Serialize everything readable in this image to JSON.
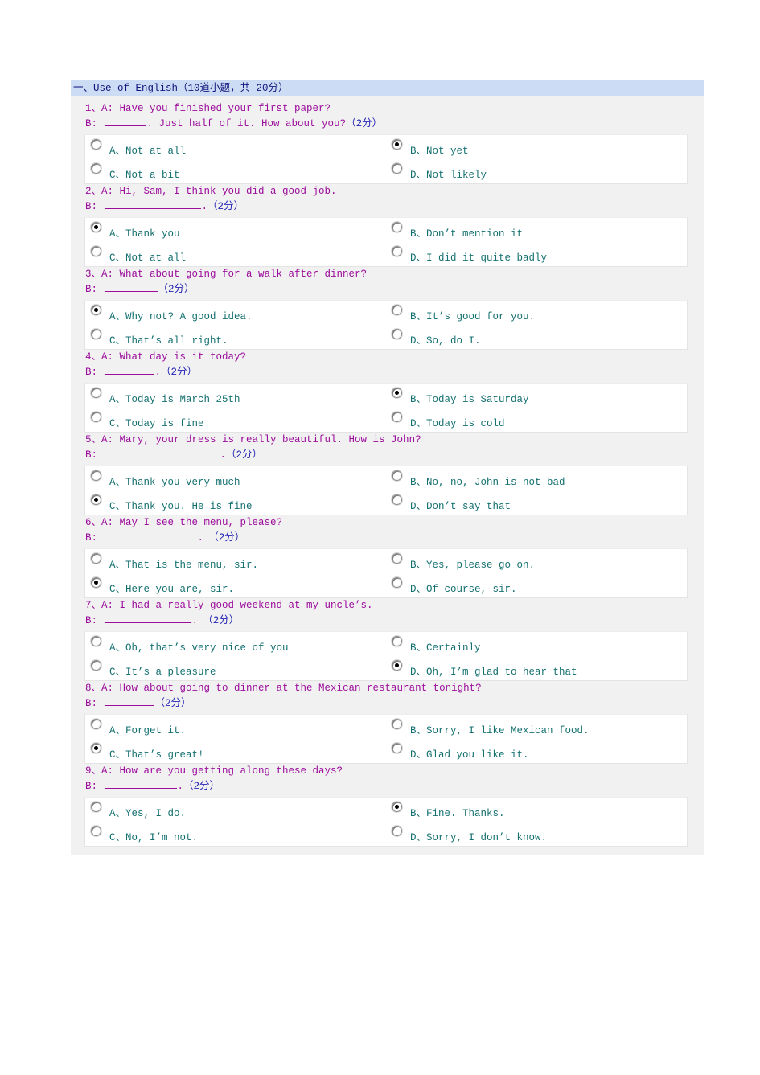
{
  "section": {
    "header": "一、Use of English（10道小题，共 20分）"
  },
  "questions": [
    {
      "prompt": "1、A: Have you finished your first paper?",
      "answer_prefix": "B: ",
      "blank_width": 52,
      "answer_suffix": ". Just half of it. How about you?",
      "marks": "（2分）",
      "options": [
        {
          "label": "A、Not  at  all",
          "selected": false
        },
        {
          "label": "B、Not  yet",
          "selected": true
        },
        {
          "label": "C、Not  a  bit",
          "selected": false
        },
        {
          "label": "D、Not  likely",
          "selected": false
        }
      ]
    },
    {
      "prompt": "2、A: Hi, Sam, I think you did a good job.",
      "answer_prefix": "B: ",
      "blank_width": 120,
      "answer_suffix": ".",
      "marks": "（2分）",
      "options": [
        {
          "label": "A、Thank  you",
          "selected": true
        },
        {
          "label": "B、Don’t  mention  it",
          "selected": false
        },
        {
          "label": "C、Not  at  all",
          "selected": false
        },
        {
          "label": "D、I  did  it  quite  badly",
          "selected": false
        }
      ]
    },
    {
      "prompt": "3、A: What about going for a walk after dinner?",
      "answer_prefix": "B: ",
      "blank_width": 66,
      "answer_suffix": "",
      "marks": "（2分）",
      "options": [
        {
          "label": "A、Why  not?  A  good  idea.",
          "selected": true
        },
        {
          "label": "B、It’s  good  for  you.",
          "selected": false
        },
        {
          "label": "C、That’s  all  right.",
          "selected": false
        },
        {
          "label": "D、So,  do  I.",
          "selected": false
        }
      ]
    },
    {
      "prompt": "4、A: What day is it today?",
      "answer_prefix": "B: ",
      "blank_width": 62,
      "answer_suffix": ".",
      "marks": "（2分）",
      "options": [
        {
          "label": "A、Today  is  March  25th",
          "selected": false
        },
        {
          "label": "B、Today  is  Saturday",
          "selected": true
        },
        {
          "label": "C、Today  is  fine",
          "selected": false
        },
        {
          "label": "D、Today  is  cold",
          "selected": false
        }
      ]
    },
    {
      "prompt": "5、A: Mary, your dress is really beautiful. How is John?",
      "answer_prefix": "B: ",
      "blank_width": 143,
      "answer_suffix": ".",
      "marks": "（2分）",
      "options": [
        {
          "label": "A、Thank  you  very  much",
          "selected": false
        },
        {
          "label": "B、No,  no,  John  is  not  bad",
          "selected": false
        },
        {
          "label": "C、Thank  you.  He  is  fine",
          "selected": true
        },
        {
          "label": "D、Don’t  say  that",
          "selected": false
        }
      ]
    },
    {
      "prompt": "6、A: May I see the menu, please?",
      "answer_prefix": "B: ",
      "blank_width": 115,
      "answer_suffix": ".",
      "marks": "　（2分）",
      "options": [
        {
          "label": "A、That  is  the  menu,  sir.",
          "selected": false
        },
        {
          "label": "B、Yes,  please  go  on.",
          "selected": false
        },
        {
          "label": "C、Here  you  are,  sir.",
          "selected": true
        },
        {
          "label": "D、Of  course,  sir.",
          "selected": false
        }
      ]
    },
    {
      "prompt": "7、A: I had a really good weekend at my uncle’s.",
      "answer_prefix": "B: ",
      "blank_width": 108,
      "answer_suffix": ".",
      "marks": "　（2分）",
      "options": [
        {
          "label": "A、Oh,  that’s  very  nice  of  you",
          "selected": false
        },
        {
          "label": "B、Certainly",
          "selected": false
        },
        {
          "label": "C、It’s  a  pleasure",
          "selected": false
        },
        {
          "label": "D、Oh,  I’m  glad  to  hear  that",
          "selected": true
        }
      ]
    },
    {
      "prompt": "8、A: How about going to dinner at the Mexican restaurant tonight?",
      "answer_prefix": "B: ",
      "blank_width": 62,
      "answer_suffix": "",
      "marks": "（2分）",
      "options": [
        {
          "label": "A、Forget  it.",
          "selected": false
        },
        {
          "label": "B、Sorry,  I  like  Mexican  food.",
          "selected": false
        },
        {
          "label": "C、That’s  great!",
          "selected": true
        },
        {
          "label": "D、Glad  you  like  it.",
          "selected": false
        }
      ]
    },
    {
      "prompt": "9、A: How are you getting along these days?",
      "answer_prefix": "B: ",
      "blank_width": 90,
      "answer_suffix": ".",
      "marks": "（2分）",
      "options": [
        {
          "label": "A、Yes,  I  do.",
          "selected": false
        },
        {
          "label": "B、Fine.  Thanks.",
          "selected": true
        },
        {
          "label": "C、No,  I’m  not.",
          "selected": false
        },
        {
          "label": "D、Sorry,  I  don’t  know.",
          "selected": false
        }
      ]
    }
  ],
  "colors": {
    "header_bg": "#cbdcf4",
    "header_text": "#11157d",
    "question_text": "#9c0d9c",
    "marks_text": "#2222b4",
    "option_text": "#157070",
    "body_bg": "#f1f1f1",
    "options_bg": "#ffffff"
  }
}
